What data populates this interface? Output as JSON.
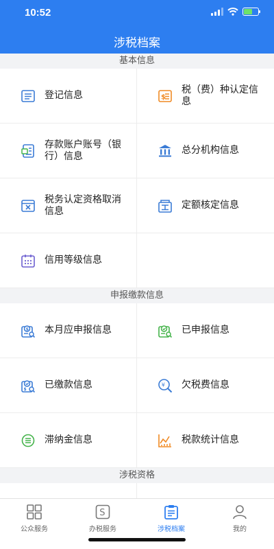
{
  "status_bar": {
    "time": "10:52"
  },
  "header": {
    "title": "涉税档案"
  },
  "sections": [
    {
      "title": "基本信息",
      "items": [
        {
          "label": "登记信息",
          "icon": "register-doc-icon"
        },
        {
          "label": "税（费）种认定信息",
          "icon": "tax-type-icon"
        },
        {
          "label": "存款账户账号（银行）信息",
          "icon": "bank-account-icon"
        },
        {
          "label": "总分机构信息",
          "icon": "institution-icon"
        },
        {
          "label": "税务认定资格取消信息",
          "icon": "qualification-cancel-icon"
        },
        {
          "label": "定额核定信息",
          "icon": "quota-icon"
        },
        {
          "label": "信用等级信息",
          "icon": "calendar-icon"
        }
      ]
    },
    {
      "title": "申报缴款信息",
      "items": [
        {
          "label": "本月应申报信息",
          "icon": "monthly-declare-icon"
        },
        {
          "label": "已申报信息",
          "icon": "declared-icon"
        },
        {
          "label": "已缴款信息",
          "icon": "paid-icon"
        },
        {
          "label": "欠税费信息",
          "icon": "overdue-tax-icon"
        },
        {
          "label": "滞纳金信息",
          "icon": "late-fee-icon"
        },
        {
          "label": "税款统计信息",
          "icon": "tax-stats-icon"
        }
      ]
    },
    {
      "title": "涉税资格",
      "items": []
    }
  ],
  "tabs": [
    {
      "label": "公众服务",
      "icon": "grid-icon"
    },
    {
      "label": "办税服务",
      "icon": "service-s-icon"
    },
    {
      "label": "涉税档案",
      "icon": "archive-icon"
    },
    {
      "label": "我的",
      "icon": "user-icon"
    }
  ],
  "colors": {
    "primary": "#2d7ef0",
    "icon_blue": "#3a7bd5",
    "icon_orange": "#f08a24",
    "icon_green": "#44b34a"
  }
}
